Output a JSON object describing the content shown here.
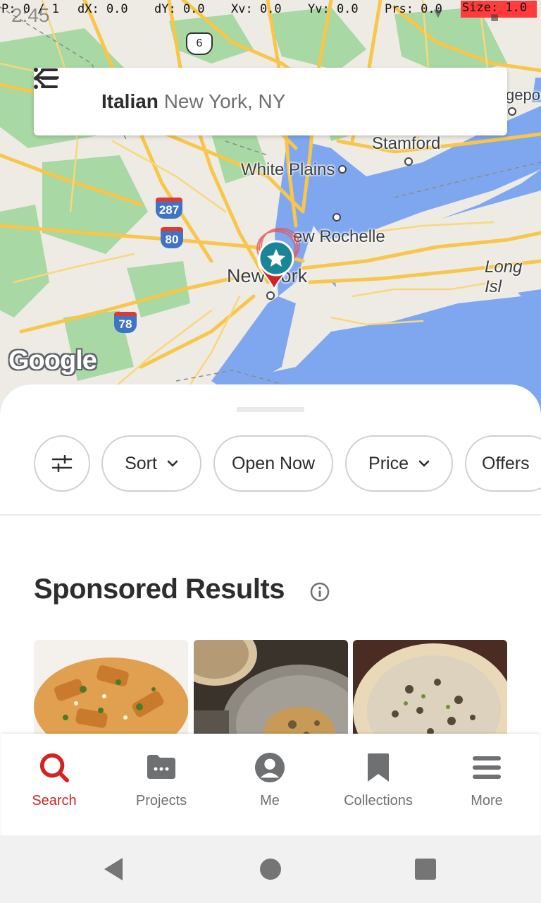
{
  "debug_bar": {
    "p": "P: 0 / 1",
    "dx": "dX: 0.0",
    "dy": "dY: 0.0",
    "xv": "Xv: 0.0",
    "yv": "Yv: 0.0",
    "prs": "Prs: 0.0",
    "size": "Size: 1.0"
  },
  "status_bar": {
    "time": "2:45"
  },
  "search": {
    "term": "Italian",
    "location": "New York, NY",
    "back_icon": "arrow-left-icon",
    "list_icon": "list-icon"
  },
  "map": {
    "attribution": "Google",
    "labels": {
      "stamford": "Stamford",
      "white_plains": "White Plains",
      "new_rochelle": "ew Rochelle",
      "new_york": "New York",
      "long_island": "Long Isl",
      "bridgeport": "geport"
    },
    "shields": {
      "i287": "287",
      "i80": "80",
      "i78": "78",
      "us6": "6"
    }
  },
  "filters": {
    "settings_icon": "sliders-icon",
    "chips": [
      {
        "label": "Sort",
        "has_dropdown": true
      },
      {
        "label": "Open Now",
        "has_dropdown": false
      },
      {
        "label": "Price",
        "has_dropdown": true
      },
      {
        "label": "Offers",
        "has_dropdown": false
      }
    ]
  },
  "sponsored": {
    "title": "Sponsored Results",
    "info_icon": "info-icon"
  },
  "tabs": [
    {
      "label": "Search",
      "icon": "search-icon",
      "active": true
    },
    {
      "label": "Projects",
      "icon": "projects-icon",
      "active": false
    },
    {
      "label": "Me",
      "icon": "user-icon",
      "active": false
    },
    {
      "label": "Collections",
      "icon": "bookmark-icon",
      "active": false
    },
    {
      "label": "More",
      "icon": "menu-icon",
      "active": false
    }
  ],
  "colors": {
    "brand_red": "#d32323",
    "text_dark": "#2d2d2d",
    "text_muted": "#6e7072",
    "map_water": "#7fa7f0",
    "map_road": "#f7c64a",
    "map_park": "#a9d8a5"
  }
}
